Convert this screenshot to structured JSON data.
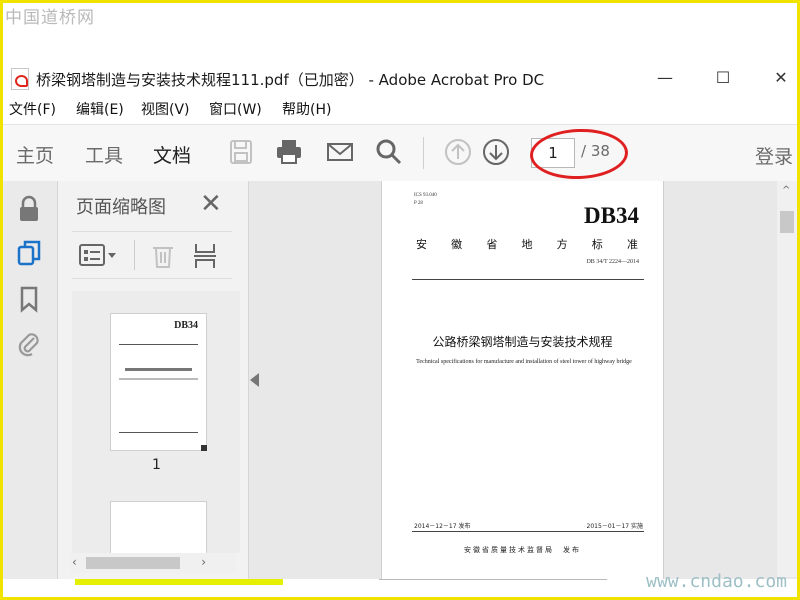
{
  "watermark": {
    "top": "中国道桥网",
    "bottom": "www.cndao.com"
  },
  "window": {
    "title": "桥梁钢塔制造与安装技术规程111.pdf（已加密） - Adobe Acrobat Pro DC",
    "minimize": "—",
    "maximize": "☐",
    "close": "✕"
  },
  "menu": [
    "文件(F)",
    "编辑(E)",
    "视图(V)",
    "窗口(W)",
    "帮助(H)"
  ],
  "toolbar": {
    "tabs": [
      "主页",
      "工具",
      "文档"
    ],
    "current_page": "1",
    "total_pages": "/ 38",
    "login": "登录"
  },
  "thumbnails": {
    "panel_title": "页面缩略图",
    "page_label": "1"
  },
  "document": {
    "ics": "ICS 93.040",
    "class": "P 28",
    "code": "DB34",
    "province_standard": [
      "安",
      "徽",
      "省",
      "地",
      "方",
      "标",
      "准"
    ],
    "number": "DB 34/T 2224—2014",
    "title_cn": "公路桥梁钢塔制造与安装技术规程",
    "title_en": "Technical specifications for manufacture and installation of steel tower of highway bridge",
    "issue_date": "2014－12－17 发布",
    "impl_date": "2015－01－17 实施",
    "issuer": "安徽省质量技术监督局　发布"
  },
  "colors": {
    "accent_red": "#e02020",
    "frame_yellow": "#f2e200"
  }
}
